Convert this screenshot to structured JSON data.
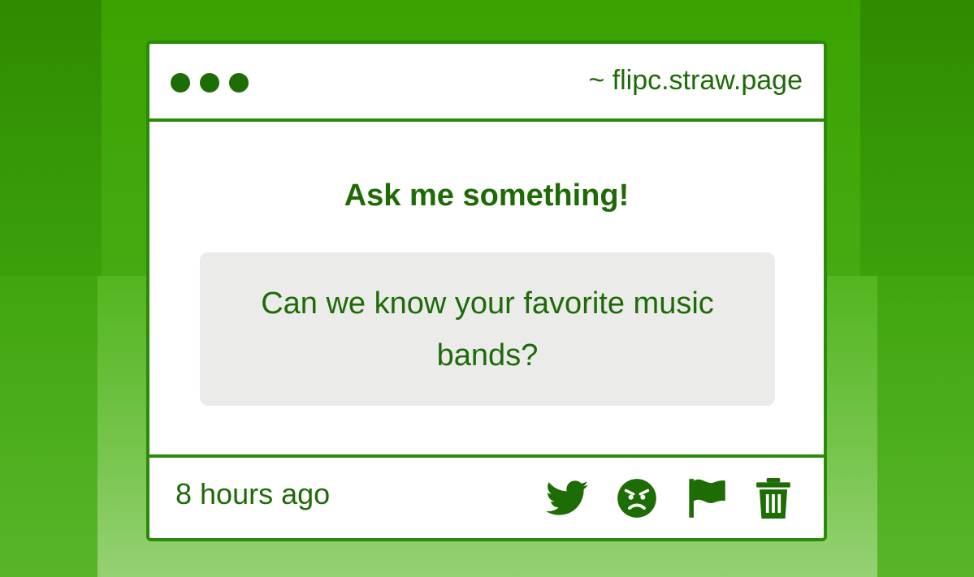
{
  "window": {
    "url": "~ flipc.straw.page"
  },
  "content": {
    "heading": "Ask me something!",
    "question": "Can we know your favorite music bands?"
  },
  "footer": {
    "timestamp": "8 hours ago",
    "icons": [
      "twitter-icon",
      "angry-face-icon",
      "flag-icon",
      "trash-icon"
    ]
  },
  "colors": {
    "accent": "#2a8a0a",
    "text": "#1f6a08",
    "question_bg": "#ebecea"
  }
}
